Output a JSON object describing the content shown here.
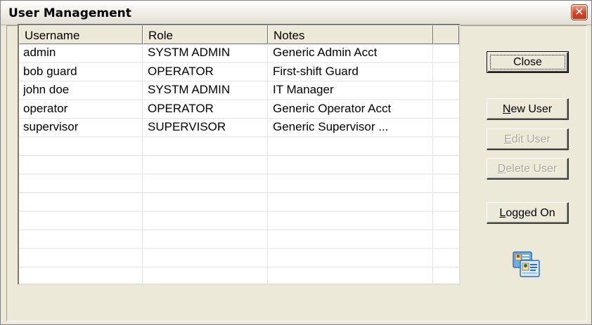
{
  "window": {
    "title": "User Management",
    "close_glyph": "✕"
  },
  "table": {
    "columns": [
      "Username",
      "Role",
      "Notes"
    ],
    "rows": [
      {
        "username": "admin",
        "role": "SYSTM ADMIN",
        "notes": "Generic Admin Acct"
      },
      {
        "username": "bob guard",
        "role": "OPERATOR",
        "notes": "First-shift Guard"
      },
      {
        "username": "john doe",
        "role": "SYSTM ADMIN",
        "notes": "IT Manager"
      },
      {
        "username": "operator",
        "role": "OPERATOR",
        "notes": "Generic Operator Acct"
      },
      {
        "username": "supervisor",
        "role": "SUPERVISOR",
        "notes": "Generic Supervisor ..."
      }
    ]
  },
  "buttons": {
    "close": "Close",
    "new_user_mn": "N",
    "new_user_rest": "ew User",
    "edit_user_mn": "E",
    "edit_user_rest": "dit User",
    "delete_user_mn": "D",
    "delete_user_rest": "elete  User",
    "logged_on_mn": "L",
    "logged_on_rest": "ogged On"
  },
  "icons": {
    "users": "users-icon",
    "close": "close-icon"
  },
  "colors": {
    "dialog_bg": "#ece9d8",
    "close_button": "#d8492a",
    "disabled_text": "#aca899"
  }
}
